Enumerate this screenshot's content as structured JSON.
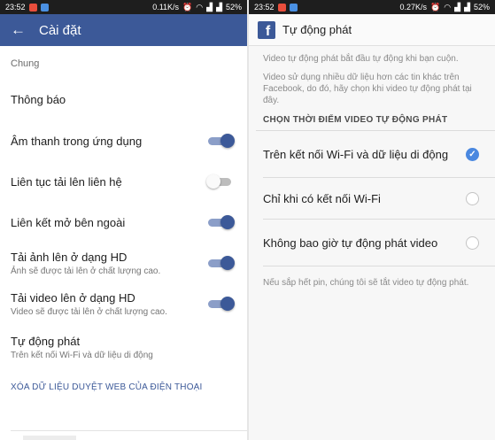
{
  "left": {
    "status": {
      "time": "23:52",
      "speed": "0.11K/s",
      "battery": "52%"
    },
    "appbar": {
      "title": "Cài đặt"
    },
    "section": "Chung",
    "items": [
      {
        "title": "Thông báo"
      },
      {
        "title": "Âm thanh trong ứng dụng",
        "toggle": "on"
      },
      {
        "title": "Liên tục tải lên liên hệ",
        "toggle": "off"
      },
      {
        "title": "Liên kết mở bên ngoài",
        "toggle": "on"
      },
      {
        "title": "Tải ảnh lên ở dạng HD",
        "subtitle": "Ảnh sẽ được tải lên ở chất lượng cao.",
        "toggle": "on"
      },
      {
        "title": "Tải video lên ở dạng HD",
        "subtitle": "Video sẽ được tải lên ở chất lượng cao.",
        "toggle": "on"
      },
      {
        "title": "Tự động phát",
        "subtitle": "Trên kết nối Wi-Fi và dữ liệu di động"
      }
    ],
    "clear_link": "XÓA DỮ LIỆU DUYỆT WEB CỦA ĐIỆN THOẠI"
  },
  "right": {
    "status": {
      "time": "23:52",
      "speed": "0.27K/s",
      "battery": "52%"
    },
    "appbar": {
      "logo": "f",
      "title": "Tự động phát"
    },
    "desc1": "Video tự động phát bắt đầu tự động khi bạn cuộn.",
    "desc2": "Video sử dụng nhiều dữ liệu hơn các tin khác trên Facebook, do đó, hãy chọn khi video tự động phát tại đây.",
    "choose_label": "CHỌN THỜI ĐIỂM VIDEO TỰ ĐỘNG PHÁT",
    "options": [
      {
        "label": "Trên kết nối Wi-Fi và dữ liệu di động",
        "selected": true
      },
      {
        "label": "Chỉ khi có kết nối Wi-Fi",
        "selected": false
      },
      {
        "label": "Không bao giờ tự động phát video",
        "selected": false
      }
    ],
    "footer_note": "Nếu sắp hết pin, chúng tôi sẽ tắt video tự động phát."
  },
  "colors": {
    "facebook_blue": "#3c5998",
    "toggle_track_on": "#8b9ec8",
    "radio_selected": "#4a88e0",
    "status_bar": "#1e1e1e"
  },
  "icons": [
    "back-arrow-icon",
    "facebook-logo-icon",
    "check-icon",
    "wifi-icon",
    "signal-icon",
    "battery-icon",
    "alarm-icon"
  ]
}
